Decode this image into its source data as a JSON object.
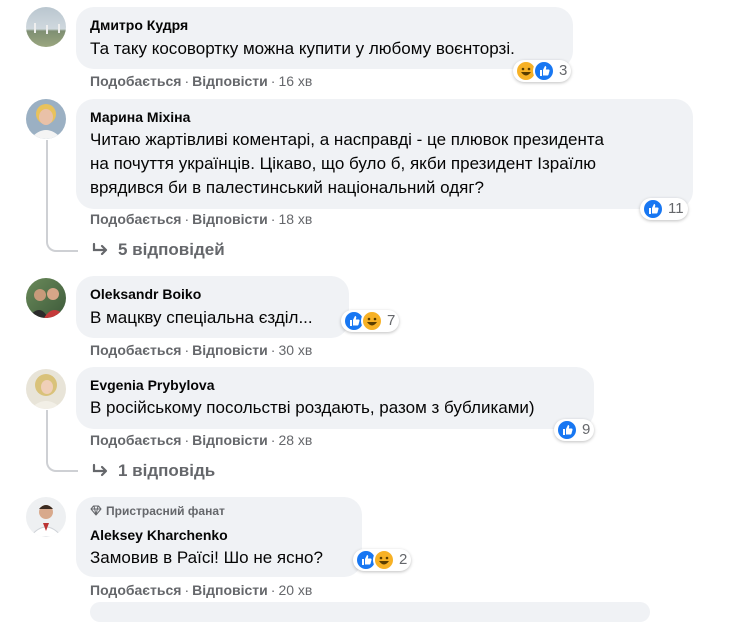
{
  "actions": {
    "like": "Подобається",
    "reply": "Відповісти",
    "dot": "·"
  },
  "comments": [
    {
      "author": "Дмитро Кудря",
      "text": "Та таку косовортку можна купити у любому воєнторзі.",
      "time": "16 хв",
      "reaction_count": "3",
      "reactions": [
        "haha-icon",
        "like-icon"
      ]
    },
    {
      "author": "Марина Міхіна",
      "text": "Читаю жартівливі коментарі, а насправді - це плювок президента\nна почуття українців. Цікаво, що було б, якби президент Ізраїлю\nврядився би в палестинський національний одяг?",
      "time": "18 хв",
      "reaction_count": "11",
      "reactions": [
        "like-icon"
      ],
      "replies_label": "5 відповідей"
    },
    {
      "author": "Oleksandr Boiko",
      "text": "В мацкву спеціальна єзділ...",
      "time": "30 хв",
      "reaction_count": "7",
      "reactions": [
        "like-icon",
        "haha-icon"
      ]
    },
    {
      "author": "Evgenia Prybylova",
      "text": "В російському посольстві роздають, разом з бубликами)",
      "time": "28 хв",
      "reaction_count": "9",
      "reactions": [
        "like-icon"
      ],
      "replies_label": "1 відповідь"
    },
    {
      "author": "Aleksey Kharchenko",
      "badge": "Пристрасний фанат",
      "text": "Замовив в Раїсі! Шо не ясно?",
      "time": "20 хв",
      "reaction_count": "2",
      "reactions": [
        "like-icon",
        "haha-icon"
      ]
    }
  ],
  "colors": {
    "bubble": "#f0f2f5",
    "secondary_text": "#65676b",
    "like_blue": "#1877f2",
    "haha_yellow": "#f7b125"
  }
}
